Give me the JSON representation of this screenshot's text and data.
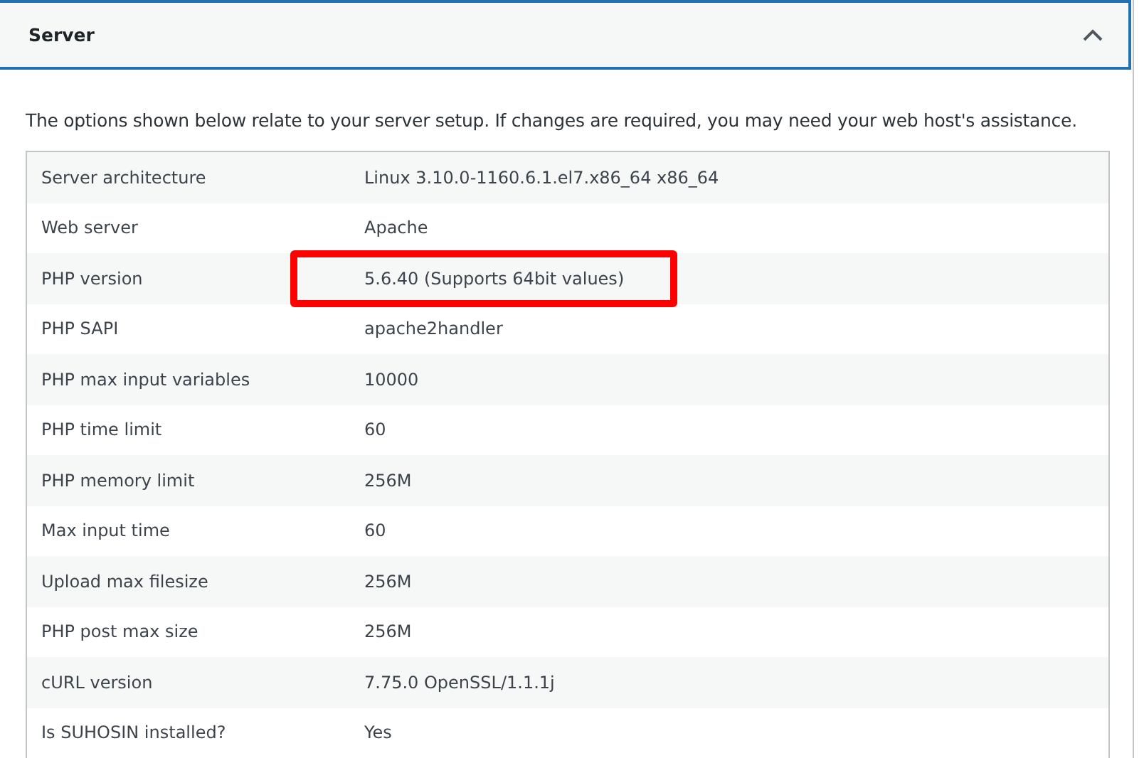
{
  "section": {
    "title": "Server",
    "expanded": true
  },
  "description": "The options shown below relate to your server setup. If changes are required, you may need your web host's assistance.",
  "rows": [
    {
      "label": "Server architecture",
      "value": "Linux 3.10.0-1160.6.1.el7.x86_64 x86_64",
      "highlighted": false
    },
    {
      "label": "Web server",
      "value": "Apache",
      "highlighted": false
    },
    {
      "label": "PHP version",
      "value": "5.6.40 (Supports 64bit values)",
      "highlighted": true
    },
    {
      "label": "PHP SAPI",
      "value": "apache2handler",
      "highlighted": false
    },
    {
      "label": "PHP max input variables",
      "value": "10000",
      "highlighted": false
    },
    {
      "label": "PHP time limit",
      "value": "60",
      "highlighted": false
    },
    {
      "label": "PHP memory limit",
      "value": "256M",
      "highlighted": false
    },
    {
      "label": "Max input time",
      "value": "60",
      "highlighted": false
    },
    {
      "label": "Upload max filesize",
      "value": "256M",
      "highlighted": false
    },
    {
      "label": "PHP post max size",
      "value": "256M",
      "highlighted": false
    },
    {
      "label": "cURL version",
      "value": "7.75.0 OpenSSL/1.1.1j",
      "highlighted": false
    },
    {
      "label": "Is SUHOSIN installed?",
      "value": "Yes",
      "highlighted": false
    }
  ]
}
